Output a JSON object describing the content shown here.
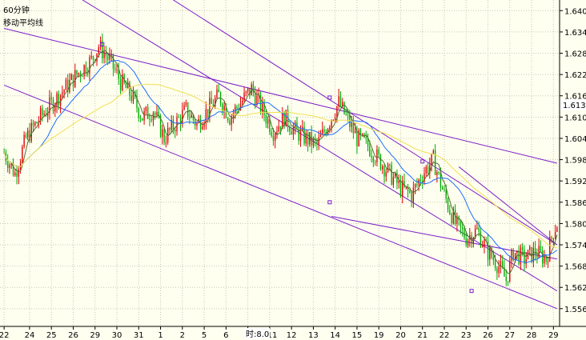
{
  "header": {
    "period": "60分钟",
    "indicator": "移动平均线"
  },
  "time_label": "时:8.0",
  "current_price": "1.613",
  "colors": {
    "background": "#fffff0",
    "grid": "#c8c8b4",
    "candle_up": "#dd0000",
    "candle_down": "#00aa00",
    "ma_short": "#556b2f",
    "ma_medium": "#1e6eff",
    "ma_long": "#f0e050",
    "trendline": "#7b1fc8"
  },
  "chart_data": {
    "type": "candlestick",
    "title": "",
    "xlabel": "",
    "ylabel": "",
    "ylim": [
      1.551,
      1.643
    ],
    "y_ticks": [
      1.64,
      1.634,
      1.628,
      1.622,
      1.616,
      1.61,
      1.604,
      1.598,
      1.592,
      1.586,
      1.58,
      1.574,
      1.568,
      1.562,
      1.556
    ],
    "y_tick_labels": [
      "1.640",
      "1.634",
      "1.628",
      "1.622",
      "1.616",
      "1.610",
      "1.604",
      "1.598",
      "1.592",
      "1.586",
      "1.580",
      "1.574",
      "1.568",
      "1.562",
      "1.556"
    ],
    "x_labels": [
      "22",
      "24",
      "25",
      "26",
      "29",
      "30",
      "31",
      "1",
      "2",
      "5",
      "6",
      "7",
      "911",
      "12",
      "13",
      "14",
      "15",
      "19",
      "20",
      "21",
      "22",
      "23",
      "26",
      "27",
      "28",
      "29"
    ],
    "x_label_bar_index": [
      0,
      14,
      26,
      38,
      50,
      62,
      74,
      86,
      98,
      110,
      122,
      134,
      146,
      158,
      170,
      182,
      194,
      206,
      218,
      230,
      242,
      254,
      266,
      278,
      290,
      302
    ],
    "bar_count": 305,
    "price_anchors": [
      [
        0,
        1.6
      ],
      [
        6,
        1.594
      ],
      [
        12,
        1.604
      ],
      [
        20,
        1.61
      ],
      [
        30,
        1.616
      ],
      [
        40,
        1.622
      ],
      [
        48,
        1.626
      ],
      [
        52,
        1.63
      ],
      [
        58,
        1.626
      ],
      [
        64,
        1.62
      ],
      [
        70,
        1.616
      ],
      [
        76,
        1.61
      ],
      [
        82,
        1.612
      ],
      [
        88,
        1.604
      ],
      [
        94,
        1.608
      ],
      [
        100,
        1.612
      ],
      [
        106,
        1.608
      ],
      [
        112,
        1.612
      ],
      [
        118,
        1.616
      ],
      [
        124,
        1.61
      ],
      [
        130,
        1.614
      ],
      [
        136,
        1.618
      ],
      [
        142,
        1.612
      ],
      [
        148,
        1.606
      ],
      [
        154,
        1.61
      ],
      [
        160,
        1.606
      ],
      [
        166,
        1.604
      ],
      [
        172,
        1.602
      ],
      [
        178,
        1.608
      ],
      [
        184,
        1.614
      ],
      [
        188,
        1.61
      ],
      [
        194,
        1.604
      ],
      [
        200,
        1.602
      ],
      [
        206,
        1.598
      ],
      [
        212,
        1.594
      ],
      [
        218,
        1.59
      ],
      [
        224,
        1.588
      ],
      [
        230,
        1.594
      ],
      [
        236,
        1.598
      ],
      [
        242,
        1.588
      ],
      [
        248,
        1.58
      ],
      [
        254,
        1.576
      ],
      [
        260,
        1.578
      ],
      [
        266,
        1.572
      ],
      [
        272,
        1.568
      ],
      [
        276,
        1.564
      ],
      [
        280,
        1.572
      ],
      [
        286,
        1.57
      ],
      [
        292,
        1.572
      ],
      [
        298,
        1.57
      ],
      [
        302,
        1.578
      ],
      [
        304,
        1.58
      ]
    ],
    "trendlines": [
      {
        "name": "",
        "points": [
          [
            0,
            1.619
          ],
          [
            304,
            1.556
          ]
        ]
      },
      {
        "name": "",
        "points": [
          [
            0,
            1.635
          ],
          [
            304,
            1.597
          ]
        ]
      },
      {
        "name": "",
        "points": [
          [
            40,
            1.644
          ],
          [
            304,
            1.561
          ]
        ]
      },
      {
        "name": "",
        "points": [
          [
            90,
            1.644
          ],
          [
            304,
            1.574
          ]
        ]
      },
      {
        "name": "",
        "points": [
          [
            180,
            1.582
          ],
          [
            304,
            1.57
          ]
        ]
      },
      {
        "name": "",
        "points": [
          [
            250,
            1.596
          ],
          [
            304,
            1.574
          ]
        ]
      }
    ],
    "markers": [
      [
        54,
        1.6305
      ],
      [
        179,
        1.6155
      ],
      [
        179,
        1.586
      ],
      [
        230,
        1.5975
      ],
      [
        257,
        1.561
      ]
    ],
    "moving_averages": [
      {
        "name": "",
        "period": 5,
        "color": "#556b2f"
      },
      {
        "name": "",
        "period": 20,
        "color": "#1e6eff"
      },
      {
        "name": "",
        "period": 60,
        "color": "#f0e050"
      }
    ],
    "grid": true,
    "legend": "none"
  }
}
